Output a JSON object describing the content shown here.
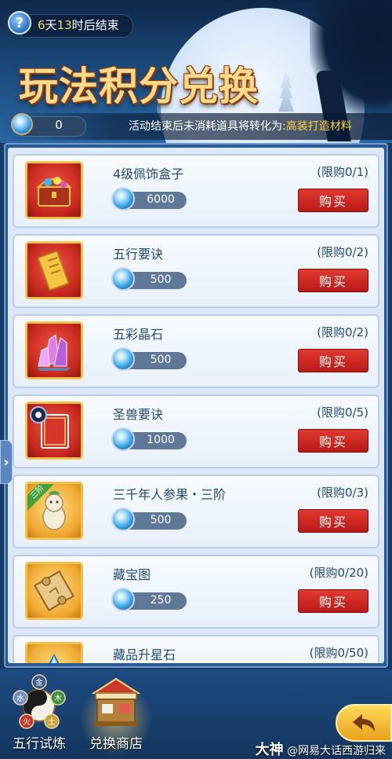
{
  "header": {
    "help_glyph": "?",
    "timer": {
      "days": "6",
      "days_unit": "天",
      "hours": "13",
      "hours_unit": "时",
      "suffix": "后结束"
    },
    "title": "玩法积分兑换"
  },
  "currency": {
    "value": "0",
    "icon": "blue-orb-icon"
  },
  "notice": {
    "text": "活动结束后未消耗道具将转化为:",
    "highlight": "高装打造材料"
  },
  "items": [
    {
      "name": "4级佩饰盒子",
      "quota": "(限购0/1)",
      "cost": "6000",
      "buy_label": "购买",
      "icon": "treasure-chest-icon",
      "frame": "red"
    },
    {
      "name": "五行要诀",
      "quota": "(限购0/2)",
      "cost": "500",
      "buy_label": "购买",
      "icon": "golden-scroll-icon",
      "frame": "red"
    },
    {
      "name": "五彩晶石",
      "quota": "(限购0/2)",
      "cost": "500",
      "buy_label": "购买",
      "icon": "crystal-icon",
      "frame": "red"
    },
    {
      "name": "圣兽要诀",
      "quota": "(限购0/5)",
      "cost": "1000",
      "buy_label": "购买",
      "icon": "red-book-icon",
      "frame": "red"
    },
    {
      "name": "三千年人参果・三阶",
      "quota": "(限购0/3)",
      "cost": "500",
      "buy_label": "购买",
      "icon": "ginseng-fruit-icon",
      "frame": "gold",
      "ribbon": "三阶"
    },
    {
      "name": "藏宝图",
      "quota": "(限购0/20)",
      "cost": "250",
      "buy_label": "购买",
      "icon": "treasure-map-icon",
      "frame": "gold"
    },
    {
      "name": "藏品升星石",
      "quota": "(限购0/50)",
      "icon": "star-stone-icon",
      "frame": "gold"
    }
  ],
  "side_tab": {
    "glyph": "›"
  },
  "nav": {
    "items": [
      {
        "label": "五行试炼",
        "icon": "five-elements-wheel-icon",
        "elements": [
          "水",
          "木",
          "金",
          "火",
          "土"
        ]
      },
      {
        "label": "兑换商店",
        "icon": "shop-stall-icon",
        "selected": true
      }
    ],
    "back_icon": "back-arrow-icon"
  },
  "watermark": {
    "brand": "大神",
    "handle": "@网易大话西游归来"
  },
  "colors": {
    "buy_button": "#c8231c",
    "notice_highlight": "#ffd23d",
    "title_gold": "#ffd98a",
    "card_text": "#234a76"
  }
}
